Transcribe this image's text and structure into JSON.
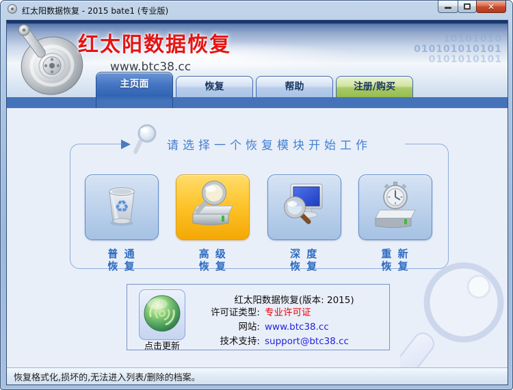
{
  "window": {
    "title": "红太阳数据恢复 - 2015 bate1 (专业版)",
    "controls": [
      "minimize",
      "maximize",
      "close"
    ],
    "close_glyph": "✕"
  },
  "header": {
    "app_title": "红太阳数据恢复",
    "website": "www.btc38.cc",
    "binary_rows": [
      "10101010",
      "010101010101",
      "0101010101"
    ]
  },
  "tabs": [
    {
      "label": "主页面",
      "active": true
    },
    {
      "label": "恢复",
      "active": false
    },
    {
      "label": "帮助",
      "active": false
    },
    {
      "label": "注册/购买",
      "active": false,
      "style": "green"
    }
  ],
  "main": {
    "heading": "请选择一个恢复模块开始工作",
    "modules": [
      {
        "icon": "recycle-bin",
        "label": "普 通\n恢 复",
        "active": false
      },
      {
        "icon": "drive-magnifier",
        "label": "高 级\n恢 复",
        "active": true
      },
      {
        "icon": "monitor-magnifier",
        "label": "深 度\n恢 复",
        "active": false
      },
      {
        "icon": "drive-stopwatch",
        "label": "重 新\n恢 复",
        "active": false
      }
    ]
  },
  "info": {
    "update_button_label": "点击更新",
    "product_line": "红太阳数据恢复(版本: 2015)",
    "rows": [
      {
        "label": "许可证类型:",
        "value": "专业许可证",
        "value_color": "#e80000"
      },
      {
        "label": "网站:",
        "value": "www.btc38.cc",
        "value_color": "#2222dd"
      },
      {
        "label": "技术支持:",
        "value": "support@btc38.cc",
        "value_color": "#2222dd"
      }
    ]
  },
  "statusbar": {
    "text": "恢复格式化,损坏的,无法进入列表/删除的档案。"
  },
  "colors": {
    "title_red": "#e41414",
    "license_red": "#e80000",
    "link_blue": "#2222dd",
    "active_tab_blue": "#3a6cba",
    "bar_blue": "#4473ba",
    "highlight_orange": "#fdc32a",
    "register_green": "#96bc4e",
    "heading_blue": "#447fd0"
  }
}
